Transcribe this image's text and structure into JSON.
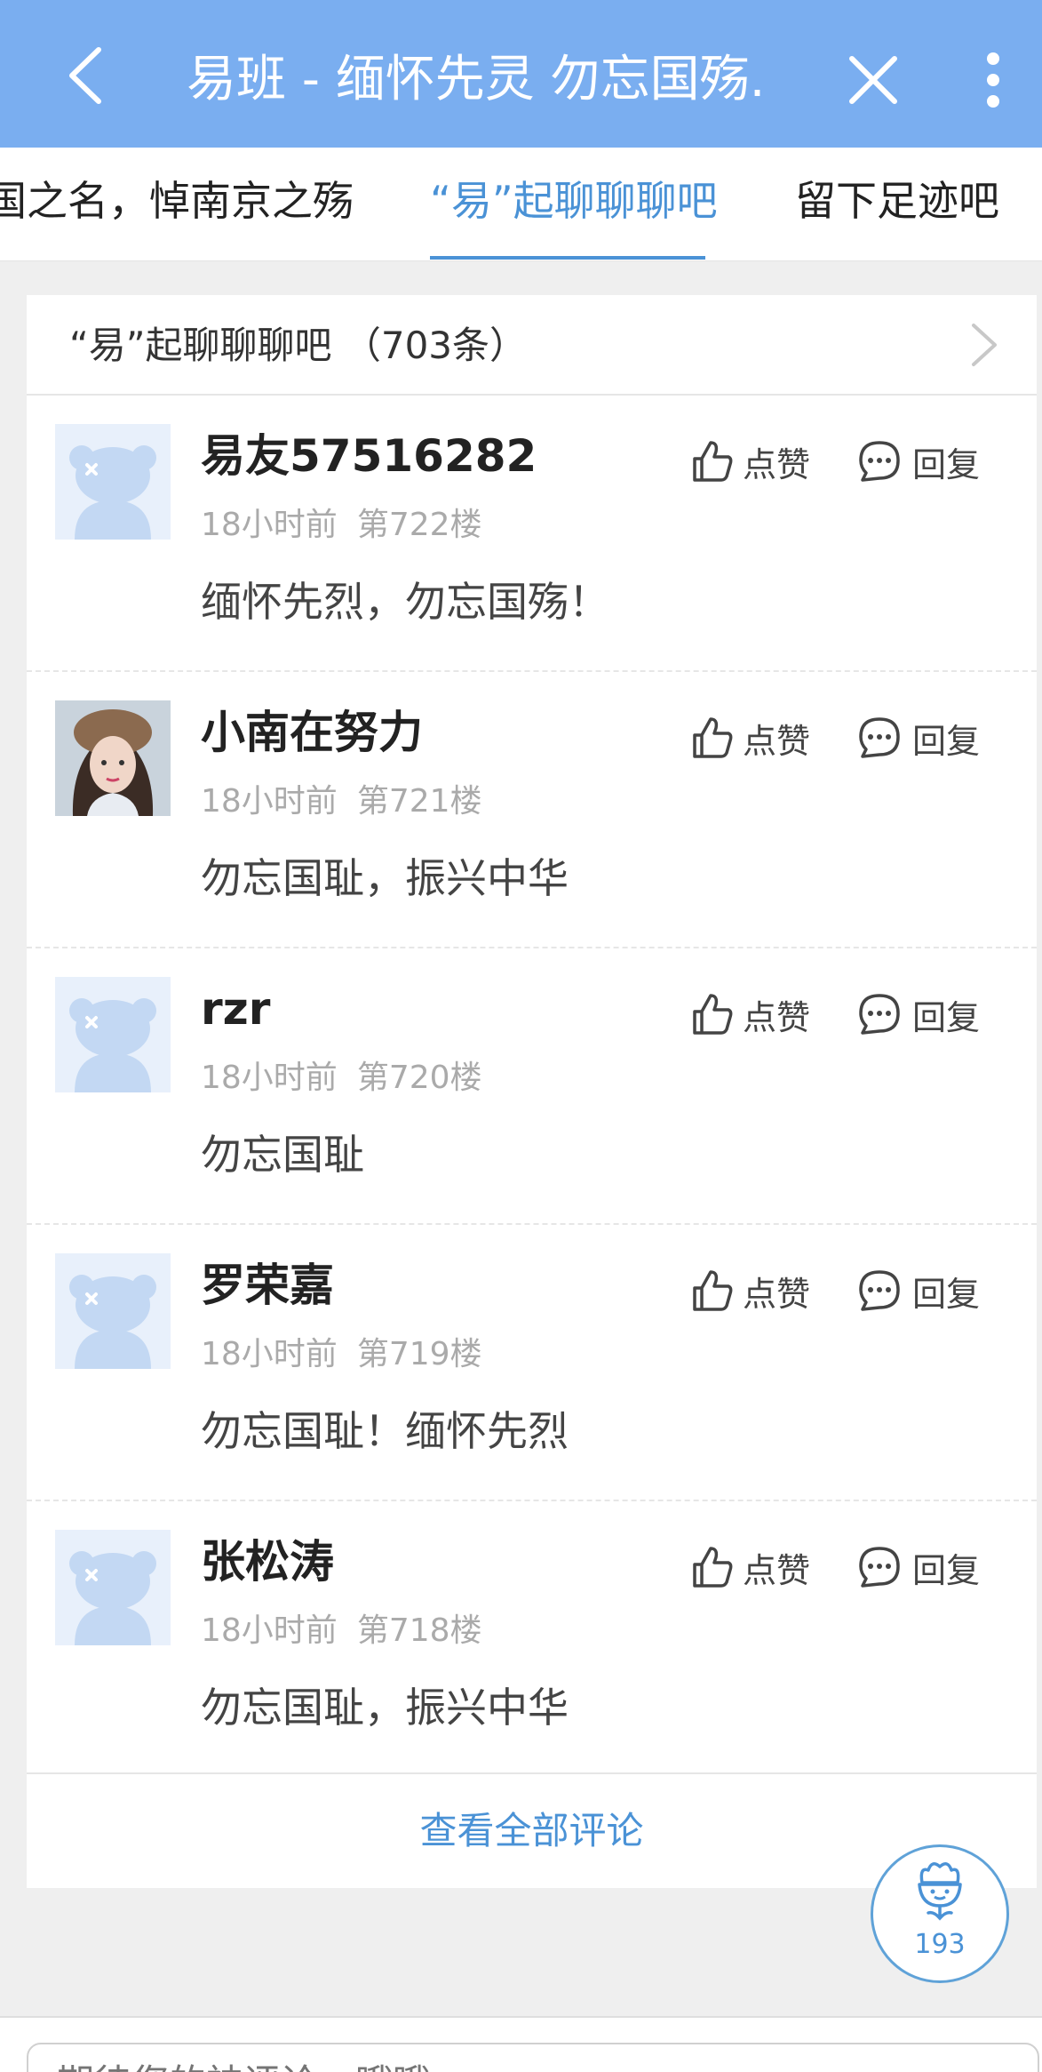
{
  "header": {
    "title": "易班 - 缅怀先灵 勿忘国殇.",
    "back_icon": "back-arrow-icon",
    "close_icon": "close-icon",
    "more_icon": "more-vertical-icon",
    "bg_color": "#7aaef0"
  },
  "tabs": [
    {
      "label": "国之名，悼南京之殇",
      "active": false
    },
    {
      "label": "“易”起聊聊聊吧",
      "active": true
    },
    {
      "label": "留下足迹吧",
      "active": false
    }
  ],
  "section": {
    "title": "“易”起聊聊聊吧 （703条）"
  },
  "comments": [
    {
      "name": "易友57516282",
      "time": "18小时前",
      "floor": "第722楼",
      "text": "缅怀先烈，勿忘国殇！",
      "avatar": "default-bear-avatar",
      "like_label": "点赞",
      "reply_label": "回复"
    },
    {
      "name": "小南在努力",
      "time": "18小时前",
      "floor": "第721楼",
      "text": "勿忘国耻，振兴中华",
      "avatar": "user-photo-avatar",
      "like_label": "点赞",
      "reply_label": "回复"
    },
    {
      "name": "rzr",
      "time": "18小时前",
      "floor": "第720楼",
      "text": "勿忘国耻",
      "avatar": "default-bear-avatar",
      "like_label": "点赞",
      "reply_label": "回复"
    },
    {
      "name": "罗荣嘉",
      "time": "18小时前",
      "floor": "第719楼",
      "text": "勿忘国耻！缅怀先烈",
      "avatar": "default-bear-avatar",
      "like_label": "点赞",
      "reply_label": "回复"
    },
    {
      "name": "张松涛",
      "time": "18小时前",
      "floor": "第718楼",
      "text": "勿忘国耻，振兴中华",
      "avatar": "default-bear-avatar",
      "like_label": "点赞",
      "reply_label": "回复"
    }
  ],
  "view_all_label": "查看全部评论",
  "float_badge": {
    "count": "193",
    "icon": "flower-icon"
  },
  "input": {
    "placeholder": "期待您的神评论，哦哦"
  },
  "colors": {
    "accent": "#4a92d6",
    "topbar": "#7aaef0"
  }
}
